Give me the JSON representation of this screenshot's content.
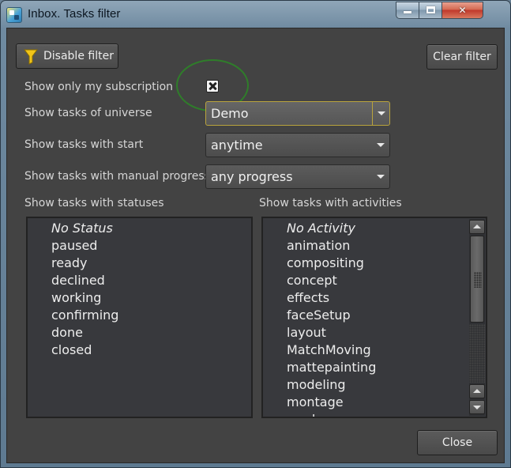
{
  "window": {
    "title": "Inbox. Tasks filter"
  },
  "toolbar": {
    "disable_filter_label": "Disable filter",
    "clear_filter_label": "Clear filter"
  },
  "options": {
    "my_subscription_label": "Show only my subscription",
    "my_subscription_checked": true,
    "universe_label": "Show tasks of universe",
    "universe_value": "Demo",
    "start_label": "Show tasks with start",
    "start_value": "anytime",
    "progress_label": "Show tasks with manual progress",
    "progress_value": "any progress"
  },
  "statuses": {
    "header": "Show tasks with statuses",
    "items": [
      "No Status",
      "paused",
      "ready",
      "declined",
      "working",
      "confirming",
      "done",
      "closed"
    ]
  },
  "activities": {
    "header": "Show tasks with activities",
    "items": [
      "No Activity",
      "animation",
      "compositing",
      "concept",
      "effects",
      "faceSetup",
      "layout",
      "MatchMoving",
      "mattepainting",
      "modeling",
      "montage",
      "producers"
    ]
  },
  "footer": {
    "close_label": "Close"
  },
  "colors": {
    "dialog_bg": "#434343",
    "list_bg": "#38393d",
    "focus_border": "#b9a43d",
    "highlight_ring": "#2f7d2a",
    "filter_icon": "#f0c419"
  }
}
